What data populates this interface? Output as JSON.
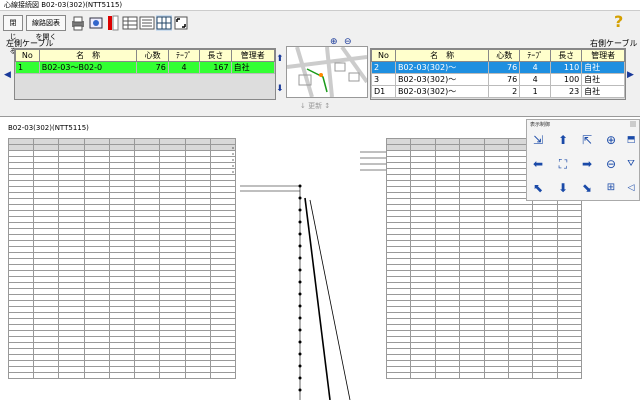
{
  "window": {
    "title": "心線接続図  B02-03(302)(NTT5115)"
  },
  "toolbar": {
    "close_label": "閉じる",
    "ledger_label": "線路図表を開く",
    "help_label": "?"
  },
  "left_panel": {
    "title": "左側ケーブル",
    "columns": [
      "No",
      "名　称",
      "心数",
      "ﾃｰﾌﾟ",
      "長さ",
      "管理者"
    ],
    "rows": [
      [
        "1",
        "B02-03～B02-0",
        "76",
        "4",
        "167",
        "自社"
      ]
    ]
  },
  "right_panel": {
    "title": "右側ケーブル",
    "columns": [
      "No",
      "名　称",
      "心数",
      "ﾃｰﾌﾟ",
      "長さ",
      "管理者"
    ],
    "rows": [
      [
        "2",
        "B02-03(302)～",
        "76",
        "4",
        "110",
        "自社"
      ],
      [
        "3",
        "B02-03(302)～",
        "76",
        "4",
        "100",
        "自社"
      ],
      [
        "D1",
        "B02-03(302)～",
        "2",
        "1",
        "23",
        "自社"
      ]
    ]
  },
  "refresh_label": "更新",
  "diagram": {
    "title": "B02-03(302)(NTT5115)"
  },
  "view_control": {
    "title": "表示制御"
  },
  "colors": {
    "selected_left": "#33ff33",
    "selected_right": "#1e8fe0",
    "header": "#ffffcc"
  }
}
